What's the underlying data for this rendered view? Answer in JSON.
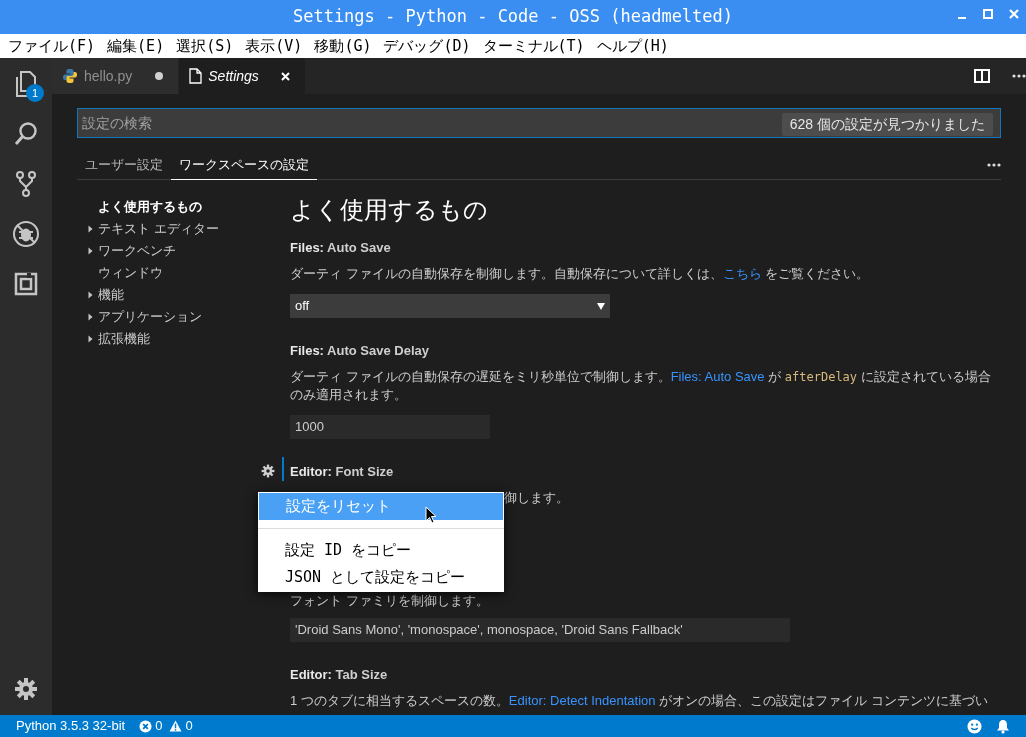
{
  "window": {
    "title": "Settings - Python - Code - OSS (headmelted)"
  },
  "menu_bar": [
    "ファイル(F)",
    "編集(E)",
    "選択(S)",
    "表示(V)",
    "移動(G)",
    "デバッグ(D)",
    "ターミナル(T)",
    "ヘルプ(H)"
  ],
  "activity_bar": [
    {
      "kind": "files",
      "badge": "1"
    },
    {
      "kind": "search"
    },
    {
      "kind": "git"
    },
    {
      "kind": "debug"
    },
    {
      "kind": "extensions"
    }
  ],
  "tabs": [
    {
      "label": "hello.py",
      "kind": "python",
      "selected": false,
      "dirty": true
    },
    {
      "label": "Settings",
      "kind": "file",
      "selected": true,
      "dirty": false
    }
  ],
  "search": {
    "placeholder": "設定の検索",
    "result_count": "628 個の設定が見つかりました"
  },
  "settings_tabs": [
    {
      "label": "ユーザー設定",
      "selected": false
    },
    {
      "label": "ワークスペースの設定",
      "selected": true
    }
  ],
  "toc": [
    {
      "label": "よく使用するもの",
      "selected": true,
      "expandable": false
    },
    {
      "label": "テキスト エディター",
      "selected": false,
      "expandable": true
    },
    {
      "label": "ワークベンチ",
      "selected": false,
      "expandable": true
    },
    {
      "label": "ウィンドウ",
      "selected": false,
      "expandable": false
    },
    {
      "label": "機能",
      "selected": false,
      "expandable": true
    },
    {
      "label": "アプリケーション",
      "selected": false,
      "expandable": true
    },
    {
      "label": "拡張機能",
      "selected": false,
      "expandable": true
    }
  ],
  "section_title": "よく使用するもの",
  "settings": [
    {
      "category": "Files:",
      "name": "Auto Save",
      "description": [
        {
          "kind": "text",
          "text": "ダーティ ファイルの自動保存を制御します。自動保存について詳しくは、"
        },
        {
          "kind": "link",
          "text": "こちら"
        },
        {
          "kind": "text",
          "text": " をご覧ください。"
        }
      ],
      "control": {
        "kind": "select",
        "value": "off"
      }
    },
    {
      "category": "Files:",
      "name": "Auto Save Delay",
      "description": [
        {
          "kind": "text",
          "text": "ダーティ ファイルの自動保存の遅延をミリ秒単位で制御します。"
        },
        {
          "kind": "link",
          "text": "Files: Auto Save"
        },
        {
          "kind": "text",
          "text": " が "
        },
        {
          "kind": "code",
          "text": "afterDelay"
        },
        {
          "kind": "text",
          "text": " に設定されている場合のみ適用されます。"
        }
      ],
      "control": {
        "kind": "input",
        "value": "1000"
      }
    },
    {
      "category": "Editor:",
      "name": "Font Size",
      "focused": true,
      "description": [
        {
          "kind": "tail",
          "text": "御します。"
        }
      ]
    },
    {
      "description": [
        {
          "kind": "text",
          "text": "フォント ファミリを制御します。"
        }
      ],
      "control": {
        "kind": "wide_input",
        "value": "'Droid Sans Mono', 'monospace', monospace, 'Droid Sans Fallback'"
      }
    },
    {
      "category": "Editor:",
      "name": "Tab Size",
      "description": [
        {
          "kind": "text",
          "text": "1 つのタブに相当するスペースの数。"
        },
        {
          "kind": "link",
          "text": "Editor: Detect Indentation"
        },
        {
          "kind": "text",
          "text": " がオンの場合、この設定はファイル コンテンツに基づい"
        }
      ]
    }
  ],
  "context_menu": [
    {
      "label": "設定をリセット",
      "selected": true
    },
    {
      "kind": "separator"
    },
    {
      "label": "設定 ID をコピー",
      "selected": false
    },
    {
      "label": "JSON として設定をコピー",
      "selected": false
    }
  ],
  "status_bar": {
    "interpreter": "Python 3.5.3 32-bit",
    "errors": "0",
    "warnings": "0"
  }
}
